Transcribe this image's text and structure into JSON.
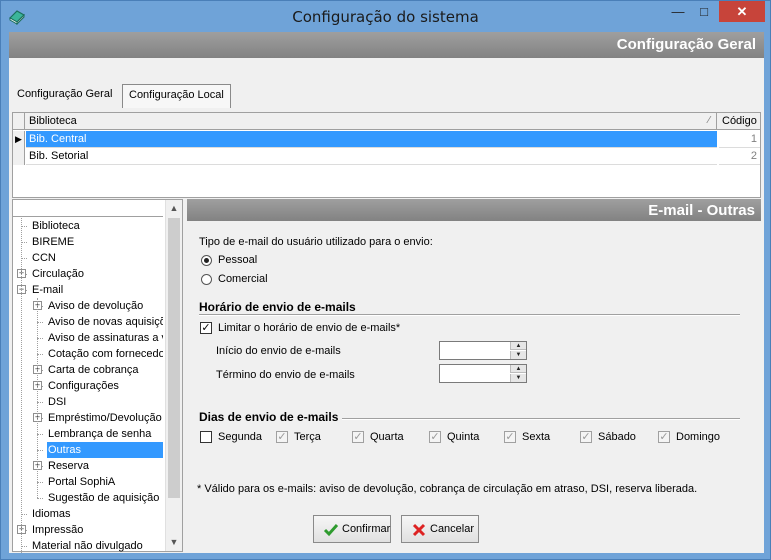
{
  "window": {
    "title": "Configuração do sistema",
    "min": "—",
    "max": "□",
    "close": "✕"
  },
  "header": {
    "title": "Configuração Geral"
  },
  "tabs": [
    {
      "label": "Configuração Geral",
      "active": false
    },
    {
      "label": "Configuração Local",
      "active": true
    }
  ],
  "grid": {
    "columns": [
      "Biblioteca",
      "Código"
    ],
    "sort_indicator": "⁄",
    "rows": [
      {
        "indicator": "▶",
        "biblioteca": "Bib. Central",
        "codigo": "1",
        "selected": true
      },
      {
        "indicator": "",
        "biblioteca": "Bib. Setorial",
        "codigo": "2",
        "selected": false
      }
    ]
  },
  "tree": {
    "items": [
      {
        "label": "Biblioteca",
        "level": 0,
        "expander": ""
      },
      {
        "label": "BIREME",
        "level": 0,
        "expander": ""
      },
      {
        "label": "CCN",
        "level": 0,
        "expander": ""
      },
      {
        "label": "Circulação",
        "level": 0,
        "expander": "+"
      },
      {
        "label": "E-mail",
        "level": 0,
        "expander": "−"
      },
      {
        "label": "Aviso de devolução",
        "level": 1,
        "expander": "+"
      },
      {
        "label": "Aviso de novas aquisiçõ",
        "level": 1,
        "expander": ""
      },
      {
        "label": "Aviso de assinaturas a v",
        "level": 1,
        "expander": ""
      },
      {
        "label": "Cotação com fornecedo",
        "level": 1,
        "expander": ""
      },
      {
        "label": "Carta de cobrança",
        "level": 1,
        "expander": "+"
      },
      {
        "label": "Configurações",
        "level": 1,
        "expander": "+"
      },
      {
        "label": "DSI",
        "level": 1,
        "expander": ""
      },
      {
        "label": "Empréstimo/Devolução",
        "level": 1,
        "expander": "+"
      },
      {
        "label": "Lembrança de senha",
        "level": 1,
        "expander": ""
      },
      {
        "label": "Outras",
        "level": 1,
        "expander": "",
        "selected": true
      },
      {
        "label": "Reserva",
        "level": 1,
        "expander": "+"
      },
      {
        "label": "Portal SophiA",
        "level": 1,
        "expander": ""
      },
      {
        "label": "Sugestão de aquisição r",
        "level": 1,
        "expander": ""
      },
      {
        "label": "Idiomas",
        "level": 0,
        "expander": ""
      },
      {
        "label": "Impressão",
        "level": 0,
        "expander": "+"
      },
      {
        "label": "Material não divulgado",
        "level": 0,
        "expander": ""
      }
    ],
    "scroll_up": "▲",
    "scroll_down": "▼"
  },
  "panel": {
    "title": "E-mail - Outras",
    "tipo_label": "Tipo de e-mail do usuário utilizado para o envio:",
    "radio_pessoal": "Pessoal",
    "radio_comercial": "Comercial",
    "horario_title": "Horário de envio de e-mails",
    "limitar_label": "Limitar o horário de envio de e-mails*",
    "limitar_checked": true,
    "inicio_label": "Início do envio de e-mails",
    "termino_label": "Término do envio de e-mails",
    "inicio_value": "",
    "termino_value": "",
    "dias_title": "Dias de envio de e-mails",
    "days": [
      {
        "label": "Segunda",
        "checked": false,
        "disabled": false
      },
      {
        "label": "Terça",
        "checked": true,
        "disabled": true
      },
      {
        "label": "Quarta",
        "checked": true,
        "disabled": true
      },
      {
        "label": "Quinta",
        "checked": true,
        "disabled": true
      },
      {
        "label": "Sexta",
        "checked": true,
        "disabled": true
      },
      {
        "label": "Sábado",
        "checked": true,
        "disabled": true
      },
      {
        "label": "Domingo",
        "checked": true,
        "disabled": true
      }
    ],
    "note": "* Válido para os e-mails: aviso de devolução, cobrança de circulação em atraso, DSI, reserva liberada."
  },
  "buttons": {
    "confirm": "Confirmar",
    "cancel": "Cancelar"
  },
  "colors": {
    "selection": "#3399ff",
    "header_band": "#8f8f8f",
    "window_frame": "#6fa3d8",
    "close_button": "#c7443a"
  }
}
